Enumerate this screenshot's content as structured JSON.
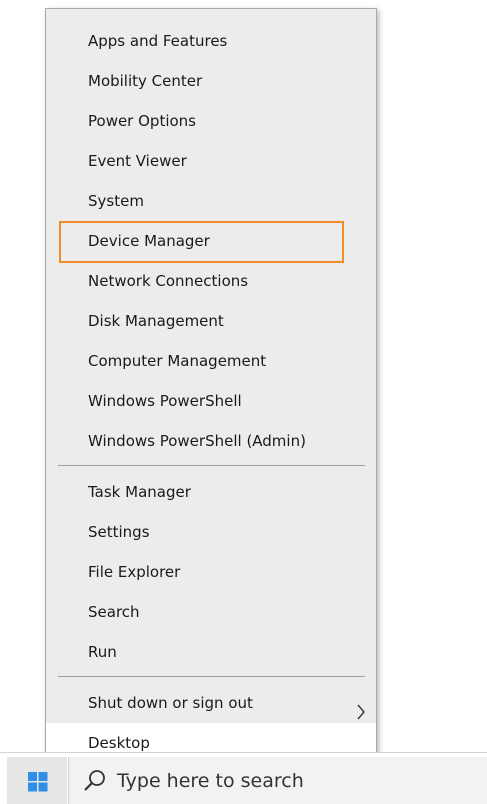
{
  "menu": {
    "group1": [
      {
        "label": "Apps and Features"
      },
      {
        "label": "Mobility Center"
      },
      {
        "label": "Power Options"
      },
      {
        "label": "Event Viewer"
      },
      {
        "label": "System"
      },
      {
        "label": "Device Manager",
        "highlighted": true
      },
      {
        "label": "Network Connections"
      },
      {
        "label": "Disk Management"
      },
      {
        "label": "Computer Management"
      },
      {
        "label": "Windows PowerShell"
      },
      {
        "label": "Windows PowerShell (Admin)"
      }
    ],
    "group2": [
      {
        "label": "Task Manager"
      },
      {
        "label": "Settings"
      },
      {
        "label": "File Explorer"
      },
      {
        "label": "Search"
      },
      {
        "label": "Run"
      }
    ],
    "group3": [
      {
        "label": "Shut down or sign out",
        "submenu_icon": "chevron-right-icon"
      },
      {
        "label": "Desktop"
      }
    ],
    "highlight_color": "#f28c28"
  },
  "taskbar": {
    "start_icon": "windows-logo-icon",
    "start_icon_color": "#2f8ee6",
    "search_icon": "search-icon",
    "search_placeholder": "Type here to search"
  }
}
